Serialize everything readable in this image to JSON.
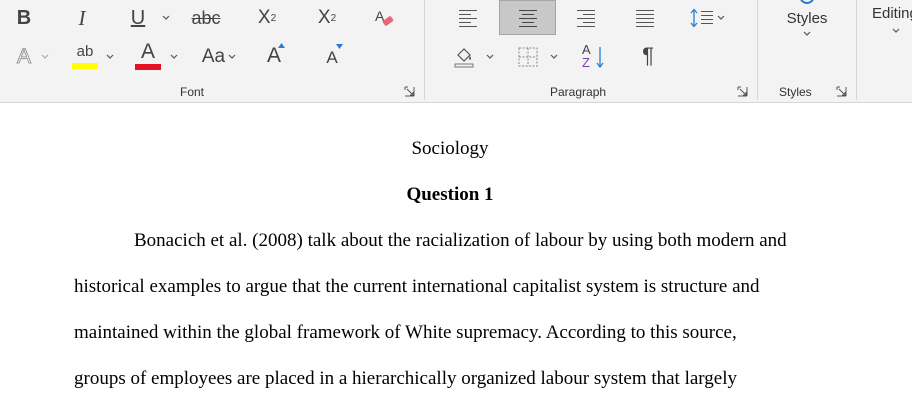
{
  "ribbon": {
    "font_group": {
      "label": "Font",
      "bold": "B",
      "italic": "I",
      "underline": "U",
      "strikethrough": "abc",
      "subscript_base": "X",
      "subscript_mark": "2",
      "superscript_base": "X",
      "superscript_mark": "2",
      "text_effects": "A",
      "highlight": "ab",
      "font_color": "A",
      "change_case": "Aa",
      "grow_font": "A",
      "shrink_font": "A",
      "highlight_color": "#ffff00",
      "font_color_value": "#e81123"
    },
    "paragraph_group": {
      "label": "Paragraph",
      "sort": "A",
      "sort_z": "Z",
      "show_marks": "¶"
    },
    "styles_group": {
      "label": "Styles",
      "button": "Styles"
    },
    "editing_group": {
      "button": "Editing"
    }
  },
  "document": {
    "title": "Sociology",
    "heading": "Question 1",
    "lines": [
      "Bonacich et al. (2008) talk about the racialization of labour by using both modern and",
      "historical examples to argue that the current international capitalist system is structure and",
      "maintained within the global framework of White supremacy. According to this source,",
      "groups of employees are placed in a hierarchically organized labour system that largely"
    ]
  }
}
